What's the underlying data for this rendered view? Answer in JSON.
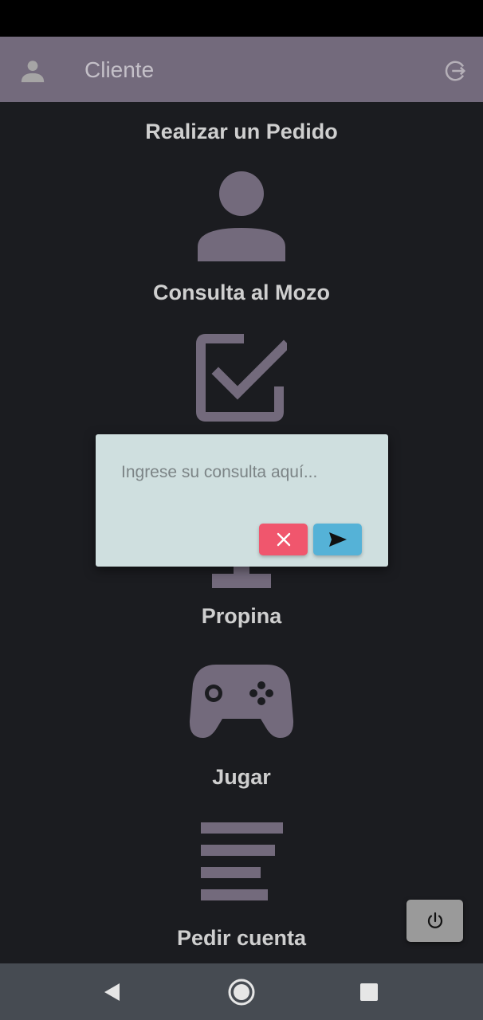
{
  "header": {
    "title": "Cliente",
    "user_icon": "person-icon",
    "logout_icon": "logout-icon"
  },
  "menu": {
    "items": [
      {
        "label": "Realizar un Pedido",
        "icon": "person-icon"
      },
      {
        "label": "Consulta al Mozo",
        "icon": "checkbox-check-icon"
      },
      {
        "label": "Propina",
        "icon": "monitor-icon"
      },
      {
        "label": "Jugar",
        "icon": "gamepad-icon"
      },
      {
        "label": "Pedir cuenta",
        "icon": "lines-icon"
      }
    ]
  },
  "dialog": {
    "input_placeholder": "Ingrese su consulta aquí...",
    "input_value": "",
    "cancel_icon": "close-icon",
    "send_icon": "send-icon"
  },
  "power_button": {
    "icon": "power-icon"
  },
  "nav": {
    "back_icon": "back-triangle-icon",
    "home_icon": "home-circle-icon",
    "recents_icon": "recents-square-icon"
  },
  "colors": {
    "background": "#1b1c20",
    "header": "#736a7c",
    "icon": "#736a7c",
    "dialog_bg": "#cfdfdf",
    "cancel": "#f0566d",
    "send": "#55b2d7",
    "power_bg": "#9a9a9a",
    "nav_bar": "#464b52"
  }
}
